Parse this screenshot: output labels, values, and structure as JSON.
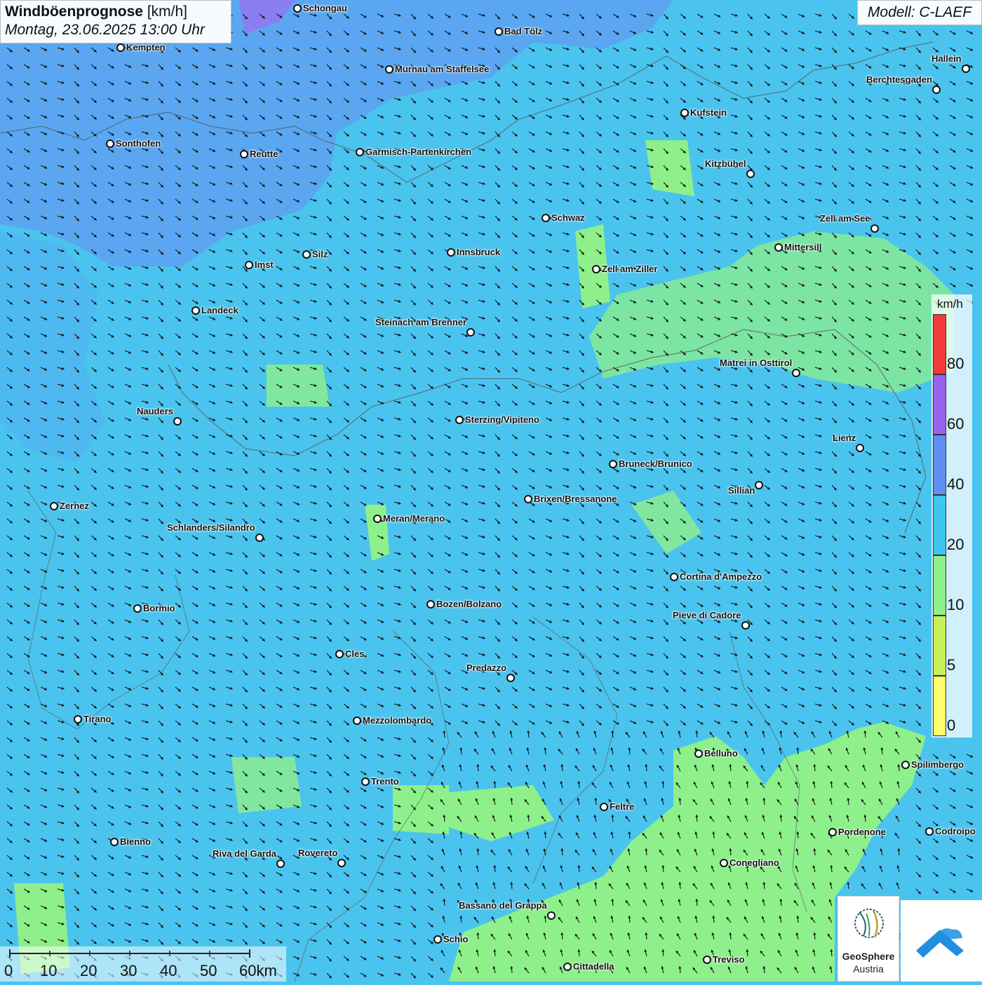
{
  "title": {
    "main": "Windböenprognose",
    "unit": "[km/h]",
    "datetime": "Montag, 23.06.2025 13:00 Uhr"
  },
  "model": "Modell: C-LAEF",
  "legend": {
    "unit": "km/h",
    "ticks": [
      "0",
      "5",
      "10",
      "20",
      "40",
      "60",
      "80"
    ],
    "colors": [
      "#fdfc6a",
      "#c6f05a",
      "#8ef08a",
      "#3ec6ee",
      "#5f8ef4",
      "#9a62f0",
      "#f23a3a"
    ]
  },
  "scale": {
    "labels": [
      "0",
      "10",
      "20",
      "30",
      "40",
      "50",
      "60km"
    ]
  },
  "logos": {
    "geosphere_line1": "GeoSphere",
    "geosphere_line2": "Austria",
    "geosphere_icon": "geosphere-logo-icon",
    "second_icon": "blue-arrow-cloud-logo-icon"
  },
  "cities": [
    {
      "name": "Schongau"
    },
    {
      "name": "Bad Tölz"
    },
    {
      "name": "Kempten"
    },
    {
      "name": "Murnau am Staffelsee"
    },
    {
      "name": "Hallein"
    },
    {
      "name": "Berchtesgaden"
    },
    {
      "name": "Kufstein"
    },
    {
      "name": "Sonthofen"
    },
    {
      "name": "Reutte"
    },
    {
      "name": "Garmisch-Partenkirchen"
    },
    {
      "name": "Kitzbühel"
    },
    {
      "name": "Schwaz"
    },
    {
      "name": "Zell am See"
    },
    {
      "name": "Mittersill"
    },
    {
      "name": "Silz"
    },
    {
      "name": "Innsbruck"
    },
    {
      "name": "Imst"
    },
    {
      "name": "Zell am Ziller"
    },
    {
      "name": "Landeck"
    },
    {
      "name": "Steinach am Brenner"
    },
    {
      "name": "Matrei in Osttirol"
    },
    {
      "name": "Nauders"
    },
    {
      "name": "Sterzing/Vipiteno"
    },
    {
      "name": "Lienz"
    },
    {
      "name": "Bruneck/Brunico"
    },
    {
      "name": "Sillian"
    },
    {
      "name": "Brixen/Bressanone"
    },
    {
      "name": "Zernez"
    },
    {
      "name": "Meran/Merano"
    },
    {
      "name": "Schlanders/Silandro"
    },
    {
      "name": "Cortina d'Ampezzo"
    },
    {
      "name": "Bozen/Bolzano"
    },
    {
      "name": "Bormio"
    },
    {
      "name": "Pieve di Cadore"
    },
    {
      "name": "Cles"
    },
    {
      "name": "Predazzo"
    },
    {
      "name": "Tirano"
    },
    {
      "name": "Mezzolombardo"
    },
    {
      "name": "Belluno"
    },
    {
      "name": "Spilimbergo"
    },
    {
      "name": "Trento"
    },
    {
      "name": "Feltre"
    },
    {
      "name": "Pordenone"
    },
    {
      "name": "Codroipo"
    },
    {
      "name": "Bienno"
    },
    {
      "name": "Riva del Garda"
    },
    {
      "name": "Rovereto"
    },
    {
      "name": "Conegliano"
    },
    {
      "name": "Bassano del Grappa"
    },
    {
      "name": "Schio"
    },
    {
      "name": "Treviso"
    },
    {
      "name": "Cittadella"
    }
  ]
}
